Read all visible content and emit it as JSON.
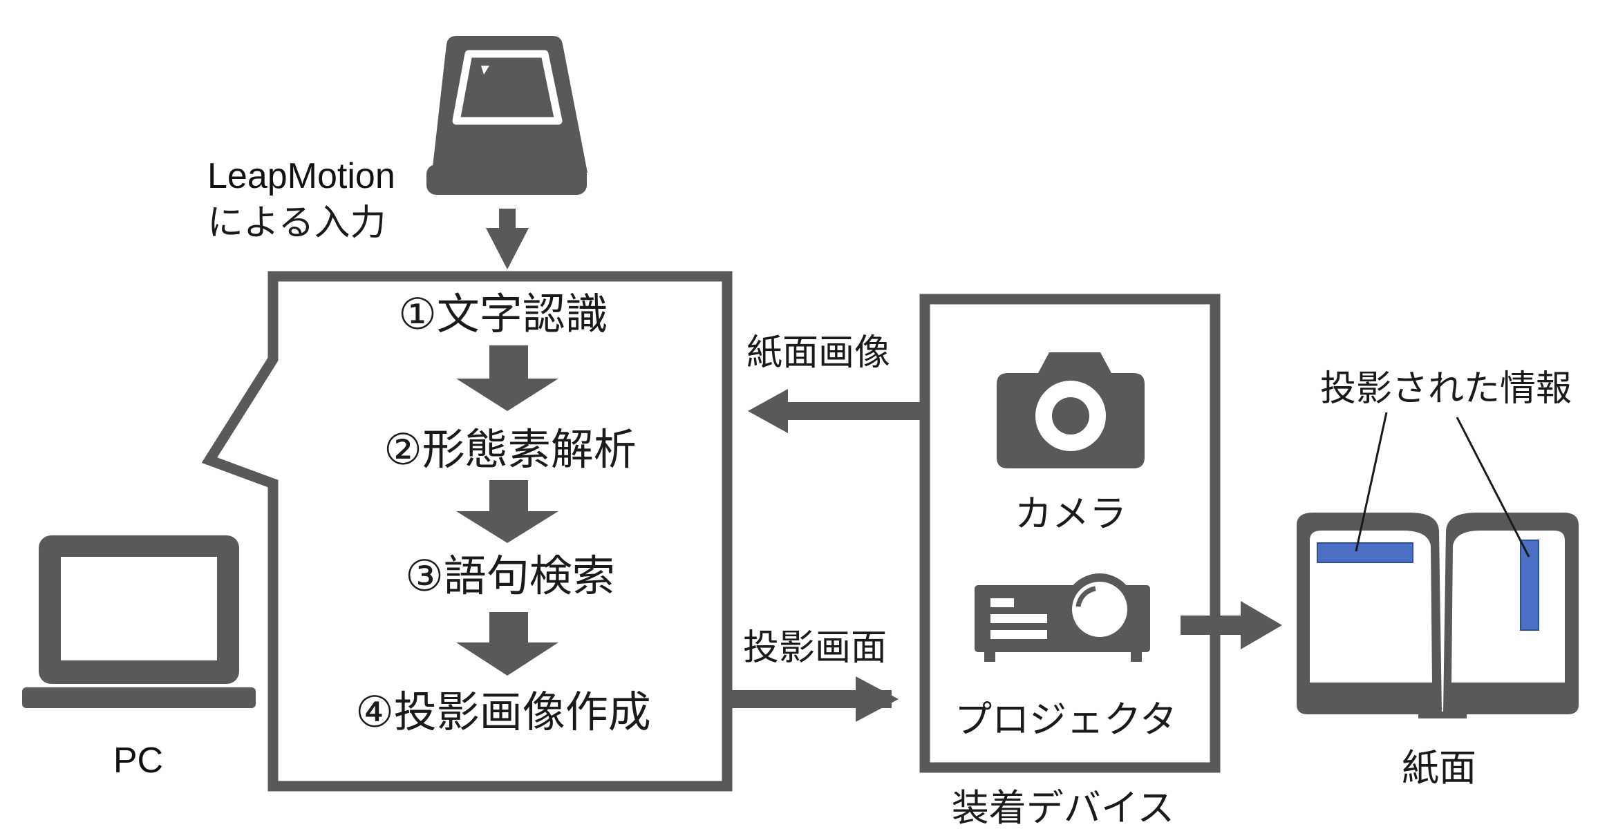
{
  "input": {
    "device_icon": "leapmotion-sensor-icon",
    "label_line1": "LeapMotion",
    "label_line2": "による入力"
  },
  "pc": {
    "icon": "laptop-icon",
    "label": "PC"
  },
  "process": {
    "steps": [
      "①文字認識",
      "②形態素解析",
      "③語句検索",
      "④投影画像作成"
    ]
  },
  "flows": {
    "paper_image": "紙面画像",
    "projection_screen": "投影画面"
  },
  "wearable": {
    "label": "装着デバイス",
    "camera": {
      "icon": "camera-icon",
      "label": "カメラ"
    },
    "projector": {
      "icon": "projector-icon",
      "label": "プロジェクタ"
    }
  },
  "paper": {
    "icon": "open-book-icon",
    "label": "紙面",
    "projected_info_label": "投影された情報",
    "highlight_color": "#4a6fc4"
  },
  "colors": {
    "icon_gray": "#595959",
    "frame_gray": "#595959"
  }
}
